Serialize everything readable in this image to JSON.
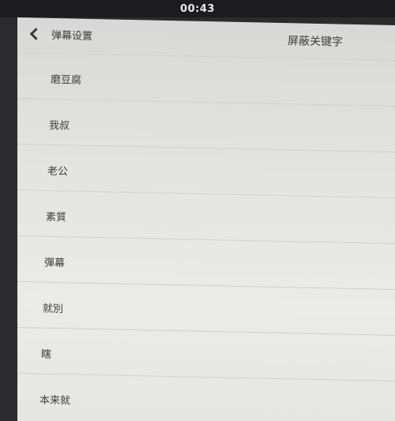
{
  "status_bar": {
    "time": "00:43"
  },
  "nav": {
    "back_label": "弹幕设置",
    "title": "屏蔽关键字"
  },
  "keywords": [
    "磨豆腐",
    "我叔",
    "老公",
    "素質",
    "彈幕",
    "就別",
    "瞎",
    "本来就"
  ]
}
